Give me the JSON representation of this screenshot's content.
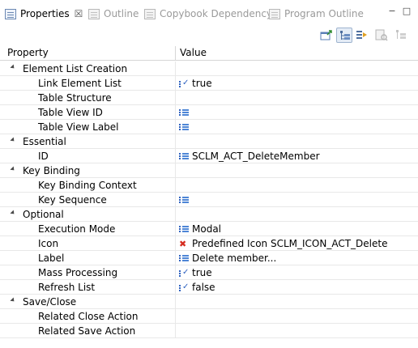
{
  "tabs": [
    {
      "label": "Properties",
      "icon": "properties-icon",
      "active": true
    },
    {
      "label": "Outline",
      "icon": "outline-icon",
      "active": false
    },
    {
      "label": "Copybook Dependency",
      "icon": "copybook-dependency-icon",
      "active": false
    },
    {
      "label": "Program Outline",
      "icon": "program-outline-icon",
      "active": false
    }
  ],
  "window_buttons": {
    "minimize": "−",
    "maximize": "□"
  },
  "toolbar": [
    "pin-to-selection-icon",
    "show-categories-icon",
    "show-advanced-icon",
    "restore-default-icon"
  ],
  "table": {
    "headers": {
      "property": "Property",
      "value": "Value"
    },
    "rows": [
      {
        "kind": "category",
        "name": "Element List Creation",
        "value": "",
        "icon": ""
      },
      {
        "kind": "child",
        "name": "Link Element List",
        "value": "true",
        "icon": "boolean-icon"
      },
      {
        "kind": "child",
        "name": "Table Structure",
        "value": "",
        "icon": ""
      },
      {
        "kind": "child",
        "name": "Table View ID",
        "value": "",
        "icon": "list-icon"
      },
      {
        "kind": "child",
        "name": "Table View Label",
        "value": "",
        "icon": "list-icon"
      },
      {
        "kind": "category",
        "name": "Essential",
        "value": "",
        "icon": ""
      },
      {
        "kind": "child",
        "name": "ID",
        "value": "SCLM_ACT_DeleteMember",
        "icon": "list-icon"
      },
      {
        "kind": "category",
        "name": "Key Binding",
        "value": "",
        "icon": ""
      },
      {
        "kind": "child",
        "name": "Key Binding Context",
        "value": "",
        "icon": ""
      },
      {
        "kind": "child",
        "name": "Key Sequence",
        "value": "",
        "icon": "list-icon"
      },
      {
        "kind": "category",
        "name": "Optional",
        "value": "",
        "icon": ""
      },
      {
        "kind": "child",
        "name": "Execution Mode",
        "value": "Modal",
        "icon": "list-icon"
      },
      {
        "kind": "child",
        "name": "Icon",
        "value": "Predefined Icon SCLM_ICON_ACT_Delete",
        "icon": "red-x-icon"
      },
      {
        "kind": "child",
        "name": "Label",
        "value": "Delete member...",
        "icon": "list-icon"
      },
      {
        "kind": "child",
        "name": "Mass Processing",
        "value": "true",
        "icon": "boolean-icon"
      },
      {
        "kind": "child",
        "name": "Refresh List",
        "value": "false",
        "icon": "boolean-icon"
      },
      {
        "kind": "category",
        "name": "Save/Close",
        "value": "",
        "icon": ""
      },
      {
        "kind": "child",
        "name": "Related Close Action",
        "value": "",
        "icon": ""
      },
      {
        "kind": "child",
        "name": "Related Save Action",
        "value": "",
        "icon": ""
      }
    ]
  }
}
